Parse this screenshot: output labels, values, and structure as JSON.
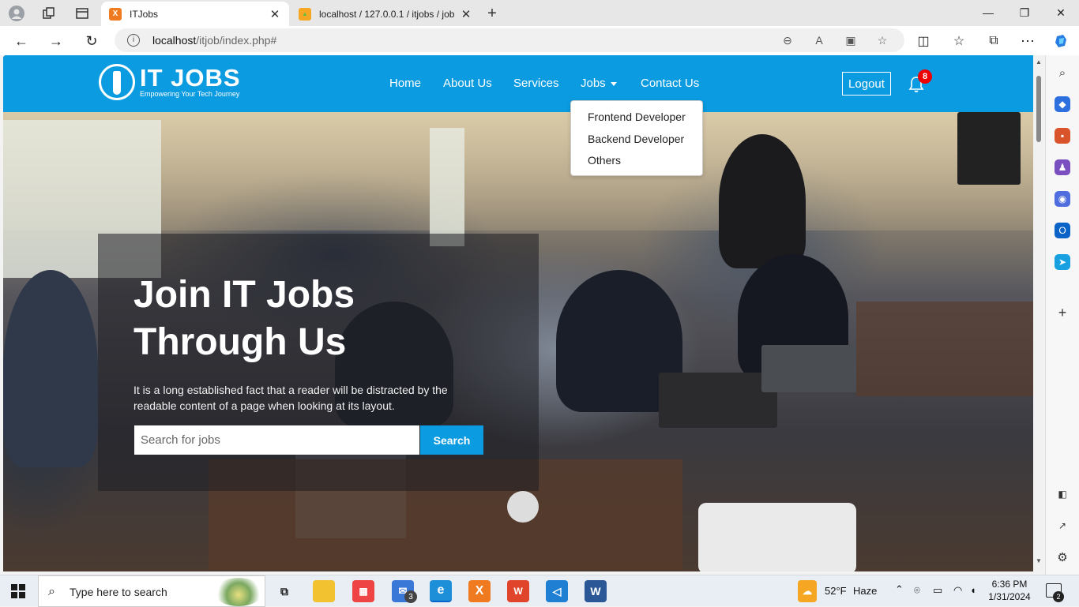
{
  "browser": {
    "tabs": [
      {
        "title": "ITJobs",
        "active": true
      },
      {
        "title": "localhost / 127.0.0.1 / itjobs / job",
        "active": false
      }
    ],
    "new_tab": "+",
    "address": {
      "host": "localhost",
      "path": "/itjob/index.php#"
    }
  },
  "site": {
    "logo": {
      "name": "IT JOBS",
      "tagline": "Empowering Your Tech Journey"
    },
    "nav": {
      "home": "Home",
      "about": "About Us",
      "services": "Services",
      "jobs": "Jobs",
      "contact": "Contact Us"
    },
    "jobs_menu": [
      "Frontend Developer",
      "Backend Developer",
      "Others"
    ],
    "logout": "Logout",
    "notifications": {
      "count": "8"
    },
    "hero": {
      "headline_1": "Join IT Jobs",
      "headline_2": "Through Us",
      "subtext": "It is a long established fact that a reader will be distracted by the readable content of a page when looking at its layout.",
      "search_placeholder": "Search for jobs",
      "search_button": "Search"
    },
    "accent_color": "#0b9be0"
  },
  "taskbar": {
    "search_placeholder": "Type here to search",
    "mail_badge": "3",
    "weather": {
      "temp": "52°F",
      "condition": "Haze"
    },
    "time": "6:36 PM",
    "date": "1/31/2024",
    "notification_count": "2"
  }
}
